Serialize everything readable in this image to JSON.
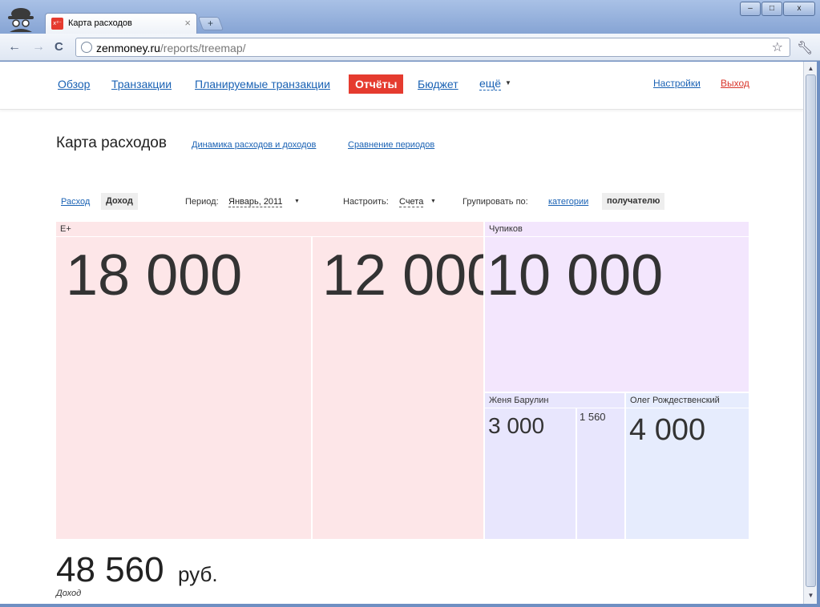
{
  "browser": {
    "tab_title": "Карта расходов",
    "tab_close": "×",
    "new_tab": "+",
    "url_host": "zenmoney.ru",
    "url_path": "/reports/treemap/",
    "window_buttons": [
      "–",
      "□",
      "x"
    ]
  },
  "nav": {
    "items": [
      "Обзор",
      "Транзакции",
      "Планируемые транзакции",
      "Отчёты",
      "Бюджет"
    ],
    "more": "ещё",
    "settings": "Настройки",
    "logout": "Выход",
    "active_color": "#e53b2f"
  },
  "page": {
    "title": "Карта расходов",
    "links": [
      "Динамика расходов и доходов",
      "Сравнение периодов"
    ]
  },
  "filters": {
    "expense": "Расход",
    "income": "Доход",
    "period_label": "Период:",
    "period_value": "Январь, 2011",
    "configure_label": "Настроить:",
    "configure_value": "Счета",
    "group_label": "Групировать по:",
    "group_category": "категории",
    "group_payee": "получателю"
  },
  "treemap": {
    "groups": [
      {
        "name": "Е+",
        "color": "#fde6e8",
        "cells": [
          {
            "value": "18 000"
          },
          {
            "value": "12 000"
          }
        ]
      },
      {
        "name": "Чупиков",
        "color": "#f3e6fd",
        "cells": [
          {
            "value": "10 000"
          }
        ]
      },
      {
        "name": "Женя Барулин",
        "color": "#e8e6fd",
        "cells": [
          {
            "value": "3 000"
          },
          {
            "value": "1 560"
          }
        ]
      },
      {
        "name": "Олег Рождественский",
        "color": "#e6ecfd",
        "cells": [
          {
            "value": "4 000"
          }
        ]
      }
    ]
  },
  "total": {
    "value": "48 560",
    "unit": "руб.",
    "label": "Доход"
  }
}
